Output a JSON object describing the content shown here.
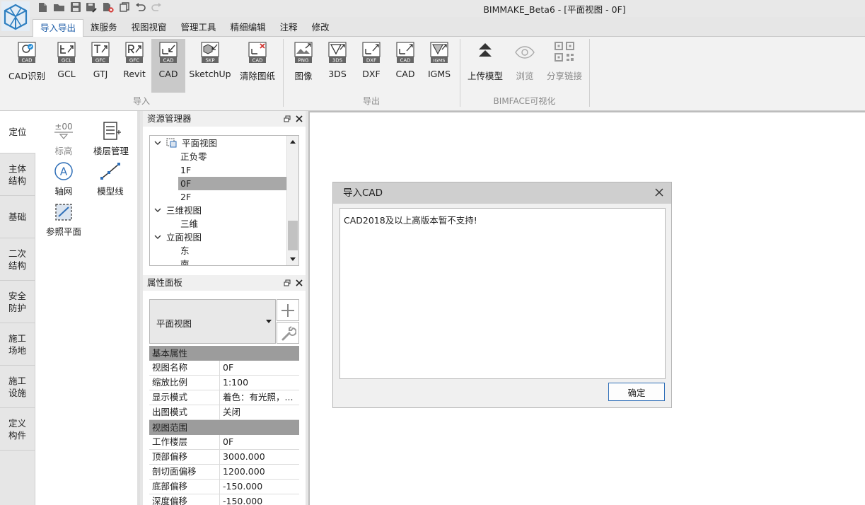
{
  "window": {
    "title": "BIMMAKE_Beta6 - [平面视图 - 0F]"
  },
  "ribbon": {
    "tabs": [
      {
        "label": "导入导出",
        "active": true
      },
      {
        "label": "族服务"
      },
      {
        "label": "视图视窗"
      },
      {
        "label": "管理工具"
      },
      {
        "label": "精细编辑"
      },
      {
        "label": "注释"
      },
      {
        "label": "修改"
      }
    ],
    "import": {
      "group_label": "导入",
      "buttons": [
        {
          "label": "CAD识别",
          "icon": "cad-recognize-icon",
          "tag": "CAD"
        },
        {
          "label": "GCL",
          "icon": "gcl-icon",
          "tag": "GCL"
        },
        {
          "label": "GTJ",
          "icon": "gtj-icon",
          "tag": "GFC"
        },
        {
          "label": "Revit",
          "icon": "revit-icon",
          "tag": "GFC"
        },
        {
          "label": "CAD",
          "icon": "cad-import-icon",
          "tag": "CAD"
        },
        {
          "label": "SketchUp",
          "icon": "sketchup-icon",
          "tag": "SKP"
        },
        {
          "label": "清除图纸",
          "icon": "clear-drawing-icon",
          "tag": "CAD"
        }
      ]
    },
    "export": {
      "group_label": "导出",
      "buttons": [
        {
          "label": "图像",
          "icon": "png-export-icon",
          "tag": "PNG"
        },
        {
          "label": "3DS",
          "icon": "3ds-export-icon",
          "tag": "3DS"
        },
        {
          "label": "DXF",
          "icon": "dxf-export-icon",
          "tag": "DXF"
        },
        {
          "label": "CAD",
          "icon": "cad-export-icon",
          "tag": "CAD"
        },
        {
          "label": "IGMS",
          "icon": "igms-export-icon",
          "tag": "IGMS"
        }
      ]
    },
    "bimface": {
      "group_label": "BIMFACE可视化",
      "buttons": [
        {
          "label": "上传模型",
          "icon": "upload-icon"
        },
        {
          "label": "浏览",
          "icon": "eye-icon"
        },
        {
          "label": "分享链接",
          "icon": "qr-code-icon"
        }
      ]
    }
  },
  "rail": {
    "items": [
      {
        "label": "定位"
      },
      {
        "label": "主体\n结构"
      },
      {
        "label": "基础"
      },
      {
        "label": "二次\n结构"
      },
      {
        "label": "安全\n防护"
      },
      {
        "label": "施工\n场地"
      },
      {
        "label": "施工\n设施"
      },
      {
        "label": "定义\n构件"
      }
    ]
  },
  "tools": {
    "elevation": {
      "label": "标高",
      "icon_text": "±00"
    },
    "floor_mgmt": {
      "label": "楼层管理"
    },
    "grid": {
      "label": "轴网",
      "icon_text": "A"
    },
    "model_line": {
      "label": "模型线"
    },
    "ref_plane": {
      "label": "参照平面"
    }
  },
  "resource_manager": {
    "title": "资源管理器",
    "tree": [
      {
        "label": "平面视图",
        "level": 0
      },
      {
        "label": "正负零",
        "level": 1
      },
      {
        "label": "1F",
        "level": 1
      },
      {
        "label": "0F",
        "level": 1,
        "selected": true
      },
      {
        "label": "2F",
        "level": 1
      },
      {
        "label": "三维视图",
        "level": 0
      },
      {
        "label": "三维",
        "level": 1
      },
      {
        "label": "立面视图",
        "level": 0
      },
      {
        "label": "东",
        "level": 1
      },
      {
        "label": "南",
        "level": 1
      }
    ]
  },
  "properties": {
    "title": "属性面板",
    "type_selector": "平面视图",
    "sections": [
      {
        "name": "基本属性",
        "rows": [
          {
            "key": "视图名称",
            "value": "0F"
          },
          {
            "key": "缩放比例",
            "value": "1:100"
          },
          {
            "key": "显示模式",
            "value": "着色：有光照，..."
          },
          {
            "key": "出图模式",
            "value": "关闭"
          }
        ]
      },
      {
        "name": "视图范围",
        "rows": [
          {
            "key": "工作楼层",
            "value": "0F"
          },
          {
            "key": "顶部偏移",
            "value": "3000.000"
          },
          {
            "key": "剖切面偏移",
            "value": "1200.000"
          },
          {
            "key": "底部偏移",
            "value": "-150.000"
          },
          {
            "key": "深度偏移",
            "value": "-150.000"
          }
        ]
      }
    ]
  },
  "dialog": {
    "title": "导入CAD",
    "message": "CAD2018及以上高版本暂不支持!",
    "ok_label": "确定"
  }
}
